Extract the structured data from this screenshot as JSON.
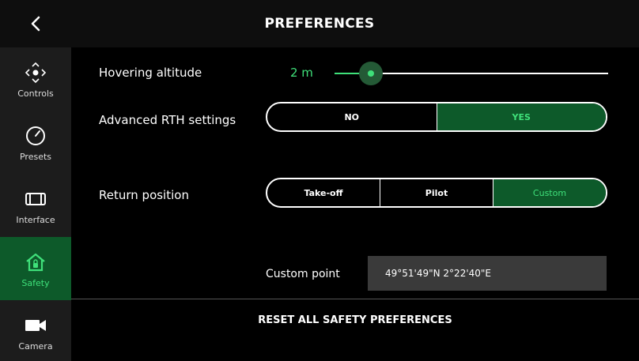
{
  "header": {
    "title": "PREFERENCES",
    "back_icon": "chevron-left-icon"
  },
  "sidebar": {
    "items": [
      {
        "label": "Controls",
        "icon": "dpad-icon",
        "active": false
      },
      {
        "label": "Presets",
        "icon": "gauge-icon",
        "active": false
      },
      {
        "label": "Interface",
        "icon": "battery-icon",
        "active": false
      },
      {
        "label": "Safety",
        "icon": "home-shield-icon",
        "active": true
      },
      {
        "label": "Camera",
        "icon": "video-camera-icon",
        "active": false
      }
    ]
  },
  "settings": {
    "hovering_altitude": {
      "label": "Hovering altitude",
      "value": "2 m",
      "slider_fraction": 0.04
    },
    "advanced_rth": {
      "label": "Advanced RTH settings",
      "options": [
        "NO",
        "YES"
      ],
      "selected": "YES"
    },
    "return_position": {
      "label": "Return position",
      "options": [
        "Take-off",
        "Pilot",
        "Custom"
      ],
      "selected": "Custom"
    },
    "custom_point": {
      "label": "Custom point",
      "value": "49°51'49\"N 2°22'40\"E"
    }
  },
  "reset": {
    "label": "RESET ALL SAFETY PREFERENCES"
  },
  "colors": {
    "accent": "#3fe07a",
    "selected_bg": "#0d5a2a",
    "sidebar_bg": "#1c1c1c"
  }
}
